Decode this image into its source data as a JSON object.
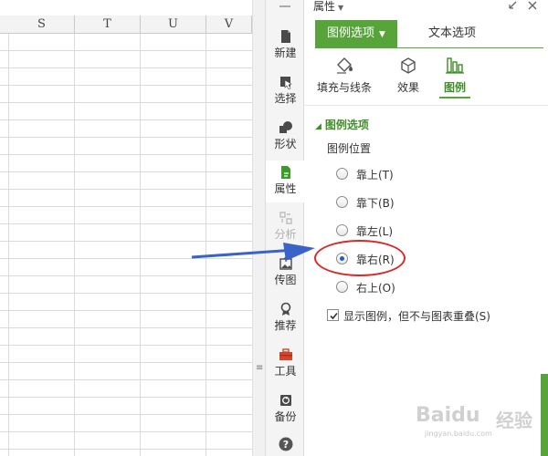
{
  "spreadsheet": {
    "columns": [
      "S",
      "T",
      "U",
      "V"
    ]
  },
  "sidebar": {
    "items": [
      {
        "label": "新建",
        "icon": "new-document-icon"
      },
      {
        "label": "选择",
        "icon": "cursor-select-icon"
      },
      {
        "label": "形状",
        "icon": "shape-icon"
      },
      {
        "label": "属性",
        "icon": "property-icon",
        "active": true
      },
      {
        "label": "分析",
        "icon": "analysis-icon",
        "disabled": true
      },
      {
        "label": "传图",
        "icon": "upload-image-icon"
      },
      {
        "label": "推荐",
        "icon": "recommend-badge-icon"
      },
      {
        "label": "工具",
        "icon": "toolbox-icon"
      },
      {
        "label": "备份",
        "icon": "backup-icon"
      },
      {
        "label": "",
        "icon": "help-icon"
      }
    ]
  },
  "panel": {
    "title": "属性",
    "tabs": {
      "legend_options": "图例选项",
      "text_options": "文本选项"
    },
    "subtabs": {
      "fill_line": "填充与线条",
      "effects": "效果",
      "legend": "图例"
    },
    "section_title": "图例选项",
    "position_label": "图例位置",
    "radios": [
      {
        "label": "靠上(T)",
        "checked": false
      },
      {
        "label": "靠下(B)",
        "checked": false
      },
      {
        "label": "靠左(L)",
        "checked": false
      },
      {
        "label": "靠右(R)",
        "checked": true
      },
      {
        "label": "右上(O)",
        "checked": false
      }
    ],
    "show_legend_label": "显示图例，但不与图表重叠(S)",
    "show_legend_checked": true
  },
  "watermark": {
    "brand": "Baidu",
    "suffix": "经验",
    "url": "jingyan.baidu.com"
  },
  "colors": {
    "accent_green": "#56a43a",
    "annotation_red": "#d62a2a",
    "arrow_blue": "#3a63c9"
  }
}
